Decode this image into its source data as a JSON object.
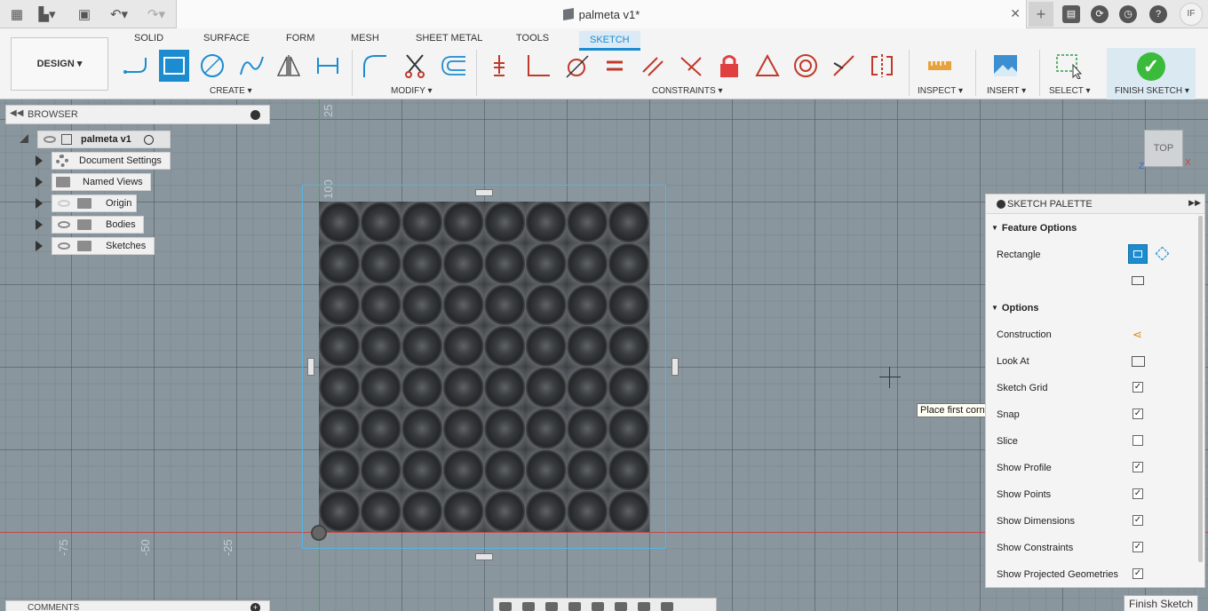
{
  "window": {
    "title": "palmeta v1*",
    "close_icon": "close-icon",
    "avatar_initials": "IF"
  },
  "toolbar": {
    "workspace_label": "DESIGN",
    "tabs": [
      "SOLID",
      "SURFACE",
      "FORM",
      "MESH",
      "SHEET METAL",
      "TOOLS",
      "SKETCH"
    ],
    "active_tab": "SKETCH",
    "groups": {
      "create": "CREATE",
      "modify": "MODIFY",
      "constraints": "CONSTRAINTS",
      "inspect": "INSPECT",
      "insert": "INSERT",
      "select": "SELECT",
      "finish": "FINISH SKETCH"
    },
    "accent": "#1b8ccf"
  },
  "browser": {
    "title": "BROWSER",
    "root": "palmeta v1",
    "items": [
      "Document Settings",
      "Named Views",
      "Origin",
      "Bodies",
      "Sketches"
    ]
  },
  "comments": {
    "title": "COMMENTS"
  },
  "canvas": {
    "axis_labels": [
      "25",
      "100",
      "-75",
      "-50",
      "-25"
    ],
    "tooltip": "Place first corner",
    "viewcube_label": "TOP",
    "viewcube_axes": [
      "Z",
      "X"
    ]
  },
  "palette": {
    "title": "SKETCH PALETTE",
    "feature_options": "Feature Options",
    "rectangle_label": "Rectangle",
    "options": "Options",
    "construction": "Construction",
    "look_at": "Look At",
    "checks": [
      {
        "label": "Sketch Grid",
        "checked": true
      },
      {
        "label": "Snap",
        "checked": true
      },
      {
        "label": "Slice",
        "checked": false
      },
      {
        "label": "Show Profile",
        "checked": true
      },
      {
        "label": "Show Points",
        "checked": true
      },
      {
        "label": "Show Dimensions",
        "checked": true
      },
      {
        "label": "Show Constraints",
        "checked": true
      },
      {
        "label": "Show Projected Geometries",
        "checked": true
      }
    ],
    "finish_button": "Finish Sketch"
  }
}
